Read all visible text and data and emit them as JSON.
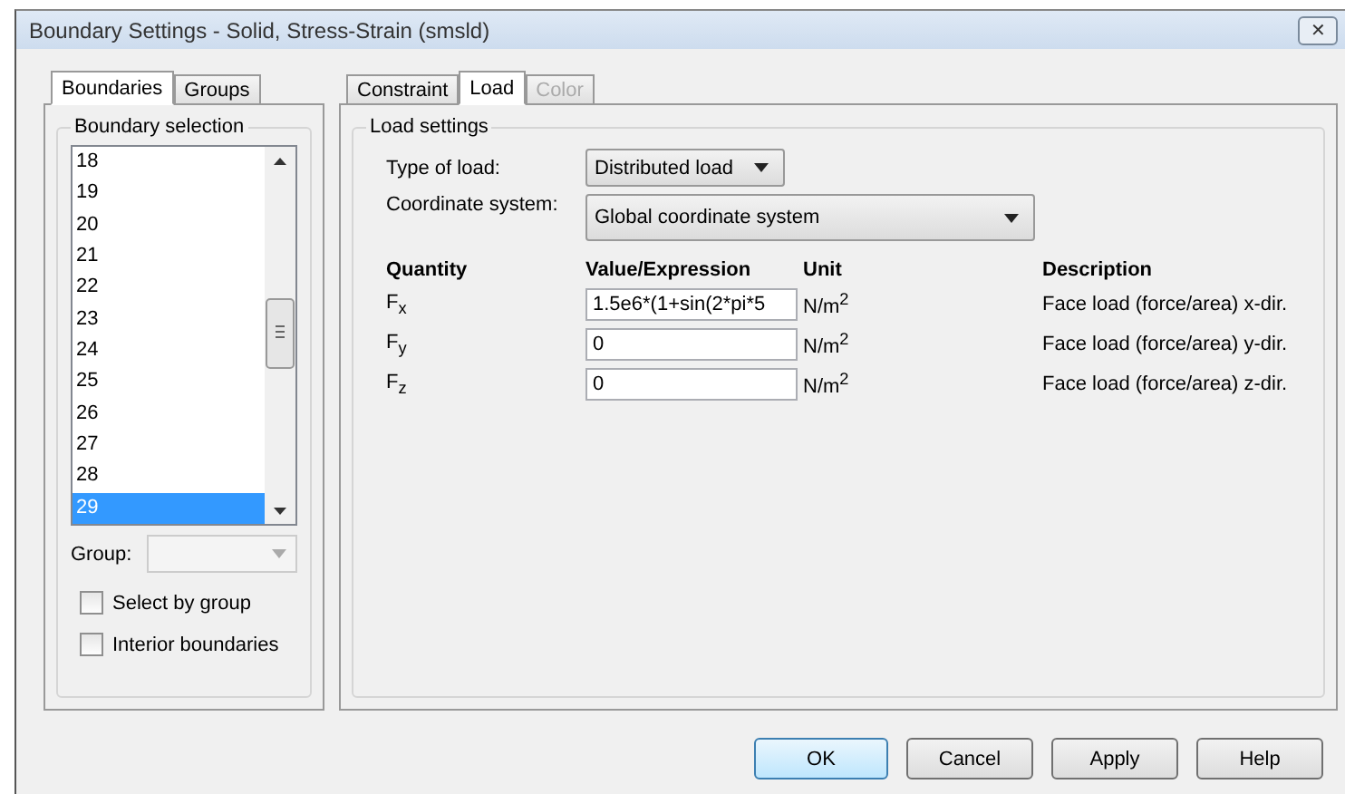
{
  "window": {
    "title": "Boundary Settings - Solid, Stress-Strain (smsld)",
    "close": "✕"
  },
  "left_tabs": [
    {
      "label": "Boundaries",
      "selected": true
    },
    {
      "label": "Groups",
      "selected": false
    }
  ],
  "boundary_selection": {
    "title": "Boundary selection",
    "items": [
      {
        "label": "18",
        "selected": false
      },
      {
        "label": "19",
        "selected": false
      },
      {
        "label": "20",
        "selected": false
      },
      {
        "label": "21",
        "selected": false
      },
      {
        "label": "22",
        "selected": false
      },
      {
        "label": "23",
        "selected": false
      },
      {
        "label": "24",
        "selected": false
      },
      {
        "label": "25",
        "selected": false
      },
      {
        "label": "26",
        "selected": false
      },
      {
        "label": "27",
        "selected": false
      },
      {
        "label": "28",
        "selected": false
      },
      {
        "label": "29",
        "selected": true
      }
    ],
    "group_label": "Group:",
    "group_disabled": true,
    "checkboxes": [
      {
        "label": "Select by group",
        "checked": false
      },
      {
        "label": "Interior boundaries",
        "checked": false
      }
    ]
  },
  "right_tabs": [
    {
      "label": "Constraint",
      "selected": false,
      "disabled": false
    },
    {
      "label": "Load",
      "selected": true,
      "disabled": false
    },
    {
      "label": "Color",
      "selected": false,
      "disabled": true
    }
  ],
  "load_settings": {
    "title": "Load settings",
    "type_of_load": {
      "label": "Type of load:",
      "value": "Distributed load"
    },
    "coordinate_system": {
      "label": "Coordinate system:",
      "value": "Global coordinate system"
    },
    "columns": [
      "Quantity",
      "Value/Expression",
      "Unit",
      "Description"
    ],
    "rows": [
      {
        "quantity": "F$_{x}$",
        "value": "1.5e6*(1+sin(2*pi*5",
        "unit": "N/m$^{2}$",
        "description": "Face load (force/area) x-dir."
      },
      {
        "quantity": "F$_{y}$",
        "value": "0",
        "unit": "N/m$^{2}$",
        "description": "Face load (force/area) y-dir."
      },
      {
        "quantity": "F$_{z}$",
        "value": "0",
        "unit": "N/m$^{2}$",
        "description": "Face load (force/area) z-dir."
      }
    ]
  },
  "buttons": [
    {
      "label": "OK",
      "default": true
    },
    {
      "label": "Cancel",
      "default": false
    },
    {
      "label": "Apply",
      "default": false
    },
    {
      "label": "Help",
      "default": false
    }
  ]
}
